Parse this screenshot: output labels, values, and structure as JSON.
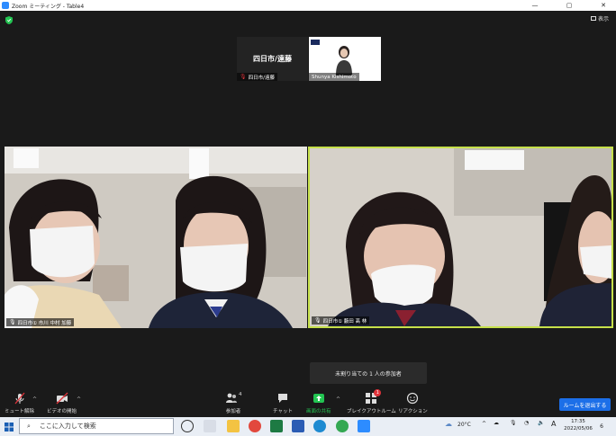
{
  "window": {
    "title": "Zoom ミーティング - Table4",
    "controls": [
      "—",
      "▢",
      "✕"
    ]
  },
  "view_button": "表示",
  "thumbnails": [
    {
      "display_name": "四日市/遠藤",
      "label": "四日市/遠藤",
      "muted": true
    },
    {
      "label": "Shunya Kishimoto",
      "muted": false
    }
  ],
  "tiles": [
    {
      "label": "四日市① 市川 中村 加藤",
      "muted": true,
      "active": false
    },
    {
      "label": "四日市① 藪田 髙 林",
      "muted": true,
      "active": true
    }
  ],
  "notice": "未割り当ての 1 人の参加者",
  "toolbar": {
    "mute": "ミュート解除",
    "video": "ビデオの開始",
    "participants": "参加者",
    "participants_count": "4",
    "chat": "チャット",
    "share": "画面の共有",
    "breakout": "ブレイクアウトルーム",
    "breakout_badge": "1",
    "reactions": "リアクション",
    "leave": "ルームを退出する"
  },
  "taskbar": {
    "search_placeholder": "ここに入力して検索",
    "weather": "20°C",
    "ime": "A",
    "time": "17:35",
    "date": "2022/05/06",
    "notif_count": "6"
  },
  "colors": {
    "active_speaker_border": "#c6e04a",
    "leave_button": "#1c6fe8",
    "share_green": "#23c552",
    "muted_red": "#e0333a"
  }
}
